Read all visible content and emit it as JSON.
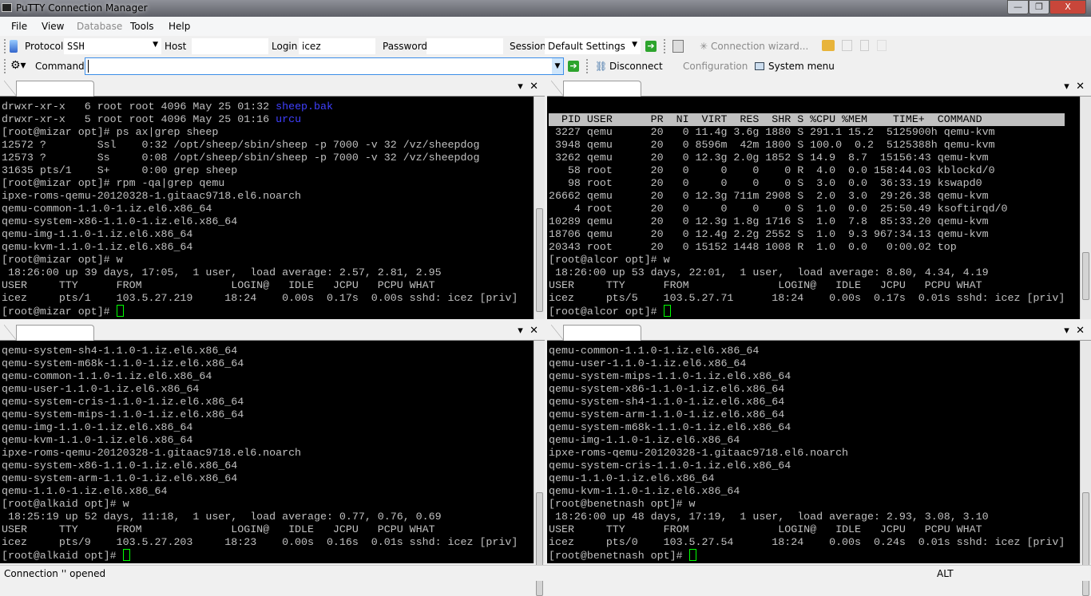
{
  "window": {
    "title": "PuTTY Connection Manager",
    "minimize": "—",
    "restore": "❐",
    "close": "X"
  },
  "menu": [
    "File",
    "View",
    "Database",
    "Tools",
    "Help"
  ],
  "toolbar1": {
    "protocol_label": "Protocol",
    "protocol_value": "SSH",
    "host_label": "Host",
    "host_value": "",
    "login_label": "Login",
    "login_value": "icez",
    "password_label": "Password",
    "session_label": "Session",
    "session_value": "Default Settings",
    "connection_wizard": "Connection wizard..."
  },
  "toolbar2": {
    "command_label": "Command",
    "command_value": "",
    "disconnect": "Disconnect",
    "configuration": "Configuration",
    "system_menu": "System menu"
  },
  "tab_controls": {
    "dropdown": "▾",
    "close": "✕"
  },
  "panes": [
    {
      "name": "mizar",
      "lines": [
        [
          {
            "t": "drwxr-xr-x   6 root root 4096 May 25 01:32 "
          },
          {
            "t": "sheep.bak",
            "c": "#4040ff"
          }
        ],
        [
          {
            "t": "drwxr-xr-x   5 root root 4096 May 25 01:16 "
          },
          {
            "t": "urcu",
            "c": "#4040ff"
          }
        ],
        [
          {
            "t": "[root@mizar opt]# ps ax|grep sheep"
          }
        ],
        [
          {
            "t": "12572 ?        Ssl    0:32 /opt/sheep/sbin/sheep -p 7000 -v 32 /vz/sheepdog"
          }
        ],
        [
          {
            "t": "12573 ?        Ss     0:08 /opt/sheep/sbin/sheep -p 7000 -v 32 /vz/sheepdog"
          }
        ],
        [
          {
            "t": "31635 pts/1    S+     0:00 grep sheep"
          }
        ],
        [
          {
            "t": "[root@mizar opt]# rpm -qa|grep qemu"
          }
        ],
        [
          {
            "t": "ipxe-roms-qemu-20120328-1.gitaac9718.el6.noarch"
          }
        ],
        [
          {
            "t": "qemu-common-1.1.0-1.iz.el6.x86_64"
          }
        ],
        [
          {
            "t": "qemu-system-x86-1.1.0-1.iz.el6.x86_64"
          }
        ],
        [
          {
            "t": "qemu-img-1.1.0-1.iz.el6.x86_64"
          }
        ],
        [
          {
            "t": "qemu-kvm-1.1.0-1.iz.el6.x86_64"
          }
        ],
        [
          {
            "t": "[root@mizar opt]# w"
          }
        ],
        [
          {
            "t": " 18:26:00 up 39 days, 17:05,  1 user,  load average: 2.57, 2.81, 2.95"
          }
        ],
        [
          {
            "t": "USER     TTY      FROM              LOGIN@   IDLE   JCPU   PCPU WHAT"
          }
        ],
        [
          {
            "t": "icez     pts/1    103.5.27.219     18:24    0.00s  0.17s  0.00s sshd: icez [priv]"
          }
        ],
        [
          {
            "t": "[root@mizar opt]# "
          },
          {
            "cursor": true
          }
        ]
      ]
    },
    {
      "name": "alcor",
      "lines": [
        [
          {
            "t": ""
          }
        ],
        [
          {
            "t": "  PID USER      PR  NI  VIRT  RES  SHR S %CPU %MEM    TIME+  COMMAND",
            "hl": true
          }
        ],
        [
          {
            "t": " 3227 qemu      20   0 11.4g 3.6g 1880 S 291.1 15.2  5125900h qemu-kvm"
          }
        ],
        [
          {
            "t": " 3948 qemu      20   0 8596m  42m 1800 S 100.0  0.2  5125388h qemu-kvm"
          }
        ],
        [
          {
            "t": " 3262 qemu      20   0 12.3g 2.0g 1852 S 14.9  8.7  15156:43 qemu-kvm"
          }
        ],
        [
          {
            "t": "   58 root      20   0     0    0    0 R  4.0  0.0 158:44.03 kblockd/0"
          }
        ],
        [
          {
            "t": "   98 root      20   0     0    0    0 S  3.0  0.0  36:33.19 kswapd0"
          }
        ],
        [
          {
            "t": "26662 qemu      20   0 12.3g 711m 2908 S  2.0  3.0  29:26.38 qemu-kvm"
          }
        ],
        [
          {
            "t": "    4 root      20   0     0    0    0 S  1.0  0.0  25:50.49 ksoftirqd/0"
          }
        ],
        [
          {
            "t": "10289 qemu      20   0 12.3g 1.8g 1716 S  1.0  7.8  85:33.20 qemu-kvm"
          }
        ],
        [
          {
            "t": "18706 qemu      20   0 12.4g 2.2g 2552 S  1.0  9.3 967:34.13 qemu-kvm"
          }
        ],
        [
          {
            "t": "20343 root      20   0 15152 1448 1008 R  1.0  0.0   0:00.02 top"
          }
        ],
        [
          {
            "t": "[root@alcor opt]# w"
          }
        ],
        [
          {
            "t": " 18:26:00 up 53 days, 22:01,  1 user,  load average: 8.80, 4.34, 4.19"
          }
        ],
        [
          {
            "t": "USER     TTY      FROM              LOGIN@   IDLE   JCPU   PCPU WHAT"
          }
        ],
        [
          {
            "t": "icez     pts/5    103.5.27.71      18:24    0.00s  0.17s  0.01s sshd: icez [priv]"
          }
        ],
        [
          {
            "t": "[root@alcor opt]# "
          },
          {
            "cursor": true
          }
        ]
      ]
    },
    {
      "name": "alkaid",
      "lines": [
        [
          {
            "t": "qemu-system-sh4-1.1.0-1.iz.el6.x86_64"
          }
        ],
        [
          {
            "t": "qemu-system-m68k-1.1.0-1.iz.el6.x86_64"
          }
        ],
        [
          {
            "t": "qemu-common-1.1.0-1.iz.el6.x86_64"
          }
        ],
        [
          {
            "t": "qemu-user-1.1.0-1.iz.el6.x86_64"
          }
        ],
        [
          {
            "t": "qemu-system-cris-1.1.0-1.iz.el6.x86_64"
          }
        ],
        [
          {
            "t": "qemu-system-mips-1.1.0-1.iz.el6.x86_64"
          }
        ],
        [
          {
            "t": "qemu-img-1.1.0-1.iz.el6.x86_64"
          }
        ],
        [
          {
            "t": "qemu-kvm-1.1.0-1.iz.el6.x86_64"
          }
        ],
        [
          {
            "t": "ipxe-roms-qemu-20120328-1.gitaac9718.el6.noarch"
          }
        ],
        [
          {
            "t": "qemu-system-x86-1.1.0-1.iz.el6.x86_64"
          }
        ],
        [
          {
            "t": "qemu-system-arm-1.1.0-1.iz.el6.x86_64"
          }
        ],
        [
          {
            "t": "qemu-1.1.0-1.iz.el6.x86_64"
          }
        ],
        [
          {
            "t": "[root@alkaid opt]# w"
          }
        ],
        [
          {
            "t": " 18:25:19 up 52 days, 11:18,  1 user,  load average: 0.77, 0.76, 0.69"
          }
        ],
        [
          {
            "t": "USER     TTY      FROM              LOGIN@   IDLE   JCPU   PCPU WHAT"
          }
        ],
        [
          {
            "t": "icez     pts/9    103.5.27.203     18:23    0.00s  0.16s  0.01s sshd: icez [priv]"
          }
        ],
        [
          {
            "t": "[root@alkaid opt]# "
          },
          {
            "cursor": true
          }
        ]
      ]
    },
    {
      "name": "benetnash",
      "lines": [
        [
          {
            "t": "qemu-common-1.1.0-1.iz.el6.x86_64"
          }
        ],
        [
          {
            "t": "qemu-user-1.1.0-1.iz.el6.x86_64"
          }
        ],
        [
          {
            "t": "qemu-system-mips-1.1.0-1.iz.el6.x86_64"
          }
        ],
        [
          {
            "t": "qemu-system-x86-1.1.0-1.iz.el6.x86_64"
          }
        ],
        [
          {
            "t": "qemu-system-sh4-1.1.0-1.iz.el6.x86_64"
          }
        ],
        [
          {
            "t": "qemu-system-arm-1.1.0-1.iz.el6.x86_64"
          }
        ],
        [
          {
            "t": "qemu-system-m68k-1.1.0-1.iz.el6.x86_64"
          }
        ],
        [
          {
            "t": "qemu-img-1.1.0-1.iz.el6.x86_64"
          }
        ],
        [
          {
            "t": "ipxe-roms-qemu-20120328-1.gitaac9718.el6.noarch"
          }
        ],
        [
          {
            "t": "qemu-system-cris-1.1.0-1.iz.el6.x86_64"
          }
        ],
        [
          {
            "t": "qemu-1.1.0-1.iz.el6.x86_64"
          }
        ],
        [
          {
            "t": "qemu-kvm-1.1.0-1.iz.el6.x86_64"
          }
        ],
        [
          {
            "t": "[root@benetnash opt]# w"
          }
        ],
        [
          {
            "t": " 18:26:00 up 48 days, 17:19,  1 user,  load average: 2.93, 3.08, 3.10"
          }
        ],
        [
          {
            "t": "USER     TTY      FROM              LOGIN@   IDLE   JCPU   PCPU WHAT"
          }
        ],
        [
          {
            "t": "icez     pts/0    103.5.27.54      18:24    0.00s  0.24s  0.01s sshd: icez [priv]"
          }
        ],
        [
          {
            "t": "[root@benetnash opt]# "
          },
          {
            "cursor": true
          }
        ]
      ]
    }
  ],
  "status": {
    "message": "Connection '' opened",
    "keys": "ALT"
  }
}
